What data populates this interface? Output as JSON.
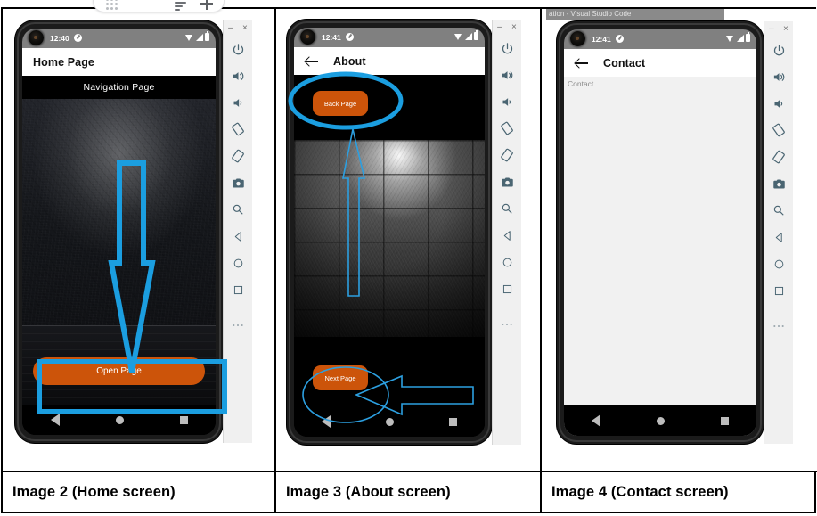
{
  "figure": {
    "columns": [
      {
        "caption": "Image  2 (Home screen)",
        "screen": {
          "status_time": "12:40",
          "app_title": "Home Page",
          "content_title": "Navigation Page",
          "primary_button": "Open Page",
          "has_back_arrow": false
        },
        "annotations": [
          "down-arrow-outline",
          "highlight-rectangle"
        ]
      },
      {
        "caption": "Image 3 (About screen)",
        "screen": {
          "status_time": "12:41",
          "app_title": "About",
          "top_button": "Back Page",
          "bottom_button": "Next Page",
          "has_back_arrow": true
        },
        "annotations": [
          "ellipse-thick",
          "up-arrow-thin",
          "ellipse-thin",
          "left-arrow-thin"
        ]
      },
      {
        "caption": "Image 4 (Contact screen)",
        "screen": {
          "status_time": "12:41",
          "app_title": "Contact",
          "body_text": "Contact",
          "has_back_arrow": true,
          "ghost_titlebar": "ation - Visual Studio Code"
        },
        "annotations": []
      }
    ]
  },
  "stray_toolbar": {
    "dots_icon": "app-grid-icon",
    "sort_icon": "sort-lines-icon",
    "plus_icon": "plus-icon"
  },
  "emulator_toolbar": {
    "minimize_label": "–",
    "close_label": "×",
    "items": [
      {
        "name": "power-icon",
        "title": "Power"
      },
      {
        "name": "volume-up-icon",
        "title": "Volume Up"
      },
      {
        "name": "volume-down-icon",
        "title": "Volume Down"
      },
      {
        "name": "rotate-left-icon",
        "title": "Rotate Left"
      },
      {
        "name": "rotate-right-icon",
        "title": "Rotate Right"
      },
      {
        "name": "camera-icon",
        "title": "Take Screenshot"
      },
      {
        "name": "zoom-icon",
        "title": "Zoom Mode"
      },
      {
        "name": "back-icon",
        "title": "Back"
      },
      {
        "name": "home-icon",
        "title": "Home"
      },
      {
        "name": "overview-icon",
        "title": "Overview"
      },
      {
        "name": "more-icon",
        "title": "More"
      }
    ]
  },
  "colors": {
    "accent_orange": "#cc540a",
    "annotation_blue": "#1b9ee0",
    "annotation_blue_thin": "#2c9fe0",
    "statusbar_gray": "#808080",
    "appbar_white": "#ffffff",
    "caption_text": "#000000"
  }
}
